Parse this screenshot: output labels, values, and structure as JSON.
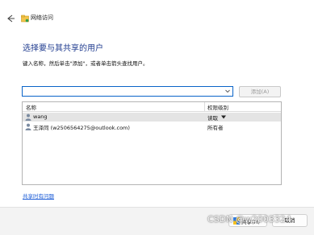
{
  "window": {
    "title": "网络访问"
  },
  "dialog": {
    "heading": "选择要与其共享的用户",
    "instruction": "键入名称，然后单击\"添加\"，或者单击箭头查找用户。",
    "input_value": "",
    "add_label": "添加(A)"
  },
  "table": {
    "columns": [
      "名称",
      "权限级别"
    ],
    "rows": [
      {
        "name": "wang",
        "permission": "读取",
        "selected": true
      },
      {
        "name": "王泽同 (w2506564275@outlook.com)",
        "permission": "所有者",
        "selected": false
      }
    ]
  },
  "help_link": "共享时有问题",
  "footer": {
    "share_label": "共享(H)",
    "cancel_label": "取消"
  },
  "watermark": "CSDN @w2003324",
  "colors": {
    "heading": "#1f3b8f",
    "link": "#1a5bd6",
    "accent": "#0a64c8",
    "selected_row": "#e4e4e4"
  },
  "icons": [
    "back-arrow-icon",
    "network-folder-icon",
    "chevron-down-icon",
    "user-icon",
    "dropdown-caret-icon",
    "shield-icon"
  ]
}
